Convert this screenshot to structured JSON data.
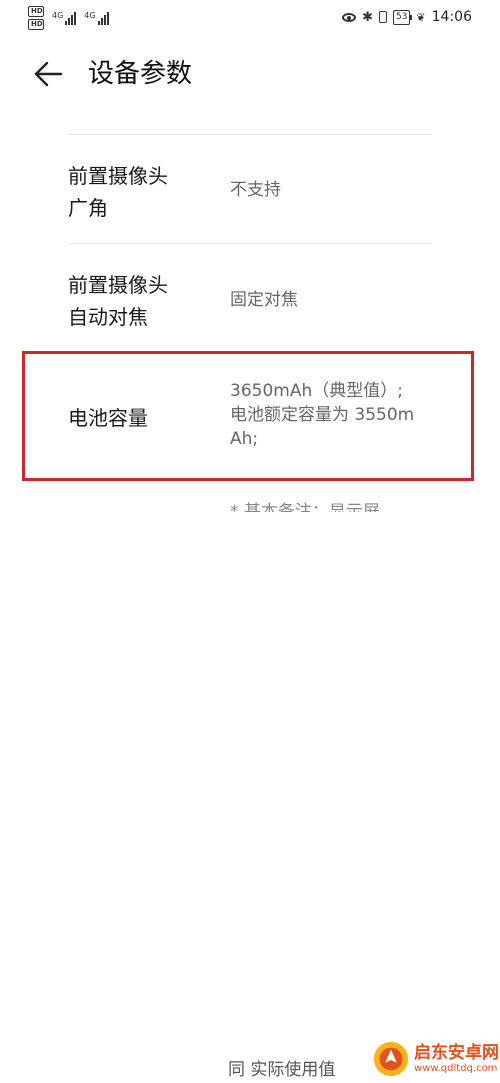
{
  "status_bar": {
    "hd_badges": [
      "HD",
      "HD"
    ],
    "sim1_network": "4G",
    "sim2_network": "4G",
    "battery_level": "53",
    "time": "14:06",
    "icons": [
      "eye-comfort-icon",
      "bluetooth-icon",
      "vibrate-icon",
      "battery-icon",
      "power-saving-leaf-icon"
    ]
  },
  "header": {
    "title": "设备参数",
    "back_icon": "arrow-left-icon"
  },
  "params": [
    {
      "label_line1": "前置摄像头",
      "label_line2": "广角",
      "value": "不支持"
    },
    {
      "label_line1": "前置摄像头",
      "label_line2": "自动对焦",
      "value": "固定对焦"
    },
    {
      "label_line1": "电池容量",
      "value_line1": "3650mAh（典型值）;",
      "value_line2": "电池额定容量为 3550m",
      "value_line3": "Ah;"
    }
  ],
  "partial_next_value": "* 基本备注：显示屏",
  "partial_bottom_text": "同 实际使用值",
  "watermark": {
    "name": "启东安卓网",
    "url": "www.qdltdq.com"
  },
  "colors": {
    "highlight": "#d0262b",
    "watermark": "#e0521f"
  }
}
